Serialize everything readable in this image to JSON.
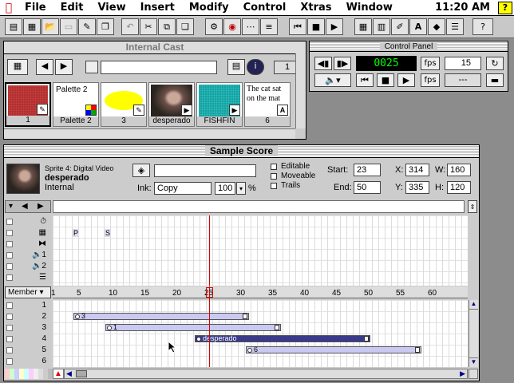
{
  "menubar": {
    "items": [
      "File",
      "Edit",
      "View",
      "Insert",
      "Modify",
      "Control",
      "Xtras",
      "Window"
    ],
    "clock": "11:20 AM",
    "help": "?"
  },
  "toolbar": {
    "icons": [
      "new-movie-icon",
      "new-cast-icon",
      "open-icon",
      "save-icon",
      "import-icon",
      "save-as-icon",
      "undo-icon",
      "cut-icon",
      "copy-icon",
      "paste-icon",
      "find-icon",
      "cast-search-icon",
      "script-icon",
      "rewind-icon",
      "stop-icon",
      "play-icon",
      "score-icon",
      "cast-window-icon",
      "paint-icon",
      "text-icon",
      "behavior-icon",
      "inspector-icon",
      "help-pointer-icon"
    ]
  },
  "cast": {
    "title": "Internal Cast",
    "name_field": "",
    "member_number": "1",
    "members": [
      {
        "label": "1",
        "type": "bitmap"
      },
      {
        "label": "Palette 2",
        "type": "palette",
        "name": "Palette 2"
      },
      {
        "label": "3",
        "type": "shape"
      },
      {
        "label": "desperado",
        "type": "video"
      },
      {
        "label": "FISHFIN",
        "type": "video"
      },
      {
        "label": "6",
        "type": "text",
        "text": "The cat sat on the mat"
      }
    ]
  },
  "control_panel": {
    "title": "Control Panel",
    "frame": "0025",
    "fps_label": "fps",
    "tempo": "15",
    "actual_fps": "---"
  },
  "score": {
    "title": "Sample Score",
    "sprite_info": {
      "header": "Sprite 4: Digital Video",
      "name": "desperado",
      "cast": "Internal"
    },
    "ink_label": "Ink:",
    "ink": "Copy",
    "blend": "100",
    "blend_unit": "%",
    "editable": "Editable",
    "moveable": "Moveable",
    "trails": "Trails",
    "start_label": "Start:",
    "start": "23",
    "end_label": "End:",
    "end": "50",
    "x_label": "X:",
    "x": "314",
    "y_label": "Y:",
    "y": "335",
    "w_label": "W:",
    "w": "160",
    "h_label": "H:",
    "h": "120",
    "member_menu": "Member",
    "ruler": [
      "1",
      "5",
      "10",
      "15",
      "20",
      "25",
      "30",
      "35",
      "40",
      "45",
      "50",
      "55",
      "60"
    ],
    "current_frame": 25,
    "palette_marker": "P",
    "sound_marker": "S",
    "channel_labels": [
      "1",
      "2",
      "3",
      "4",
      "5",
      "6"
    ],
    "spans": [
      {
        "channel": 2,
        "start": 4,
        "end": 31,
        "label": "3"
      },
      {
        "channel": 3,
        "start": 9,
        "end": 36,
        "label": "1"
      },
      {
        "channel": 4,
        "start": 23,
        "end": 50,
        "label": "desperado",
        "selected": true
      },
      {
        "channel": 5,
        "start": 31,
        "end": 58,
        "label": "6"
      }
    ]
  }
}
